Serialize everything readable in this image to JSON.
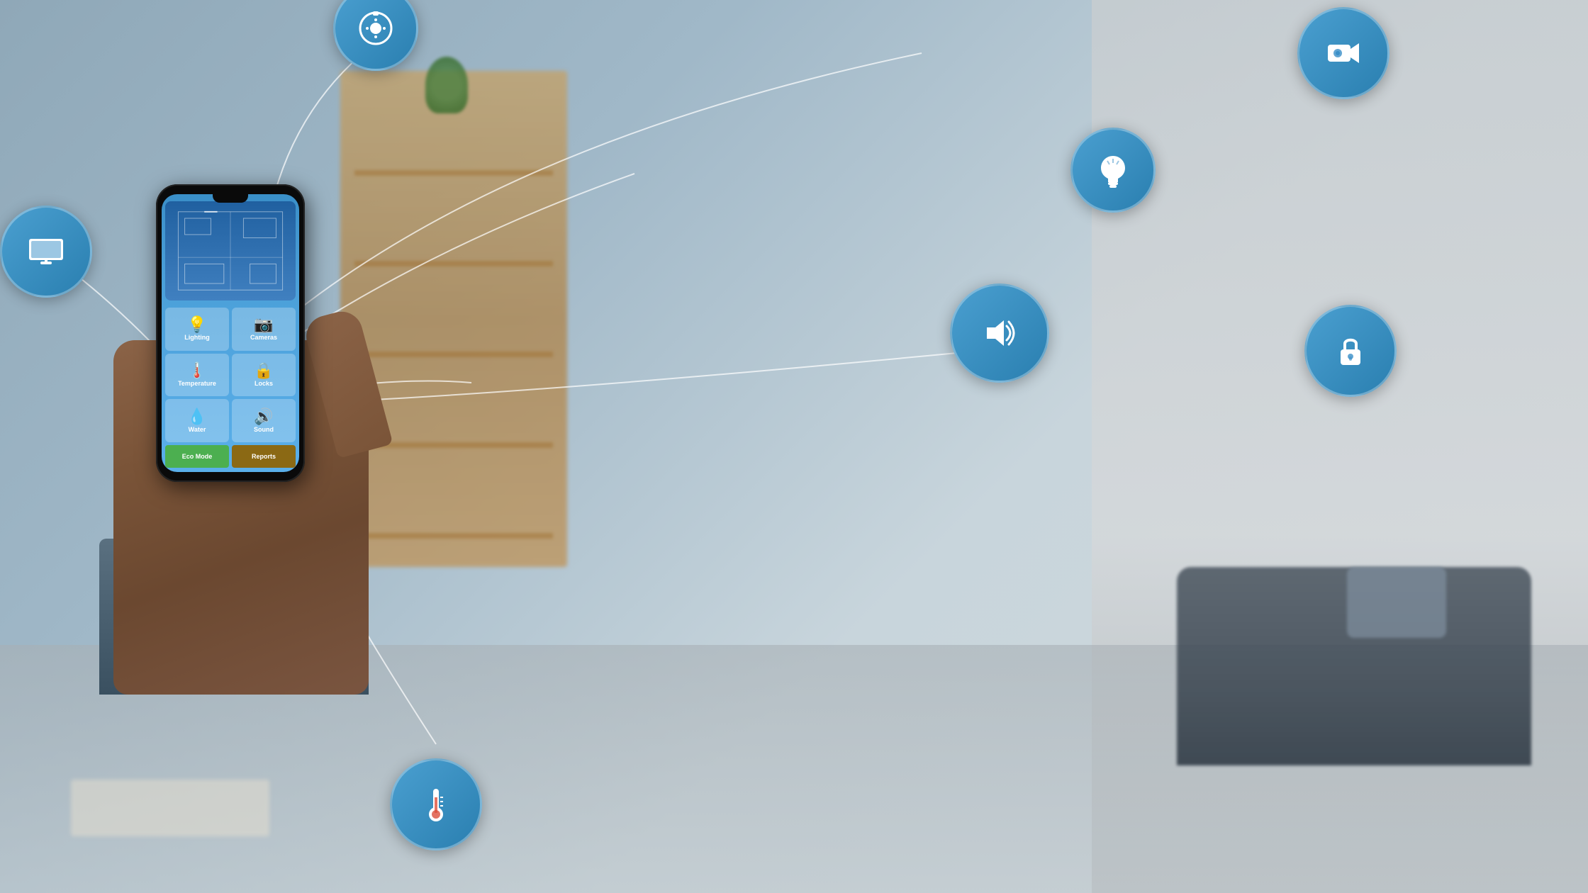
{
  "background": {
    "color": "#b0bec5"
  },
  "phone": {
    "screen_color": "#3a8fc8",
    "room_preview_alt": "Smart home room blueprint"
  },
  "app_tiles": [
    {
      "id": "lighting",
      "label": "Lighting",
      "icon": "💡"
    },
    {
      "id": "cameras",
      "label": "Cameras",
      "icon": "📷"
    },
    {
      "id": "temperature",
      "label": "Temperature",
      "icon": "🌡️"
    },
    {
      "id": "locks",
      "label": "Locks",
      "icon": "🔒"
    },
    {
      "id": "water",
      "label": "Water",
      "icon": "💧"
    },
    {
      "id": "sound",
      "label": "Sound",
      "icon": "🔊"
    }
  ],
  "buttons": {
    "eco_mode": "Eco Mode",
    "reports": "Reports"
  },
  "iot_icons": [
    {
      "id": "smoke-detector",
      "label": "Smoke Detector",
      "position": "top-center"
    },
    {
      "id": "security-camera",
      "label": "Security Camera",
      "position": "top-right"
    },
    {
      "id": "tv-display",
      "label": "TV Display",
      "position": "left"
    },
    {
      "id": "light-bulb",
      "label": "Light Bulb",
      "position": "right-upper"
    },
    {
      "id": "speaker-sound",
      "label": "Speaker/Sound",
      "position": "center-right"
    },
    {
      "id": "door-lock",
      "label": "Door Lock",
      "position": "far-right"
    },
    {
      "id": "thermometer",
      "label": "Thermometer",
      "position": "bottom-center"
    }
  ]
}
